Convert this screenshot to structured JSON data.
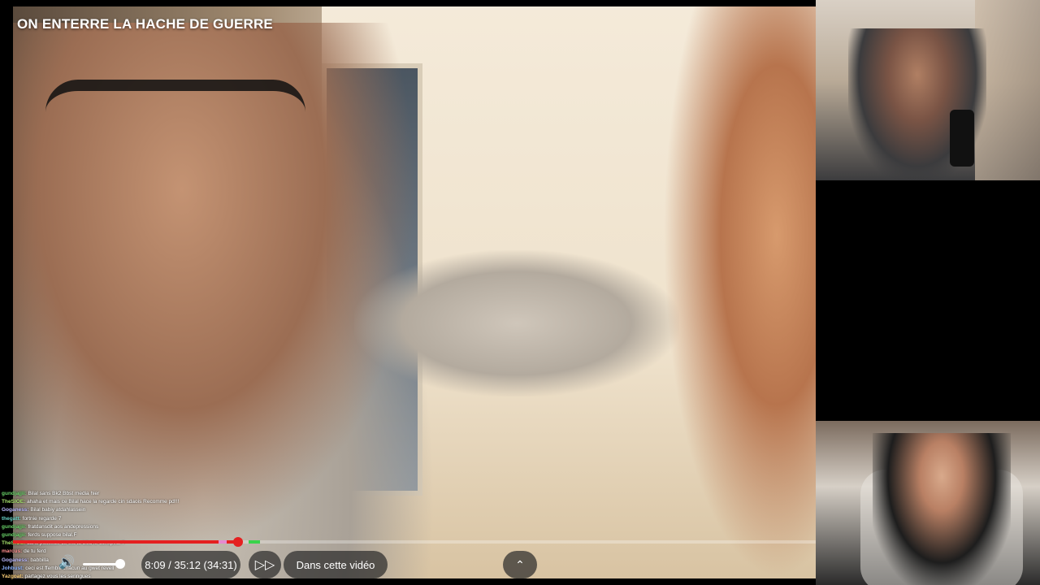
{
  "video": {
    "title": "ON ENTERRE LA HACHE DE GUERRE",
    "time_display": "8:09 / 35:12 (34:31)",
    "chapters_label": "Dans cette vidéo",
    "progress": 0.28,
    "volume_level": 0.85
  },
  "icons": {
    "volume": "volume-icon",
    "sponsor": "sponsorblock-icon",
    "chevron": "chevron-up-icon"
  },
  "chat": [
    {
      "user": "gundjajjii",
      "message": "Bilal sans Bk2 Bbst media hier",
      "color": "#6ad46a"
    },
    {
      "user": "TheSIOE",
      "message": "ahaha et mais ce Bilal hace la regarde cin sdaois Recomme pd!!!",
      "color": "#a5e06a"
    },
    {
      "user": "Goganess",
      "message": "Bilal babiy atdahlassein",
      "color": "#b9b9ff"
    },
    {
      "user": "thegatt",
      "message": "fortnie regarde 7",
      "color": "#6ad4c8"
    },
    {
      "user": "gundjajjii",
      "message": "fratdansdit aos andepressions",
      "color": "#6ad46a"
    },
    {
      "user": "gundjajjii",
      "message": "ferds suppose bilal.F",
      "color": "#6ad46a"
    },
    {
      "user": "TheSIOE",
      "message": "dans posséde ce est tu bilal le conspect ?",
      "color": "#a5e06a"
    },
    {
      "user": "marcus",
      "message": "de tu ferd",
      "color": "#ff8c8c"
    },
    {
      "user": "Goganess",
      "message": "babbilla",
      "color": "#b9b9ff"
    },
    {
      "user": "Johbust",
      "message": "ceci est ffemblii chacun au gwet revell",
      "color": "#8cb4ff"
    },
    {
      "user": "Yazgoat",
      "message": "partagez vous les seringues",
      "color": "#ffd27a"
    }
  ]
}
